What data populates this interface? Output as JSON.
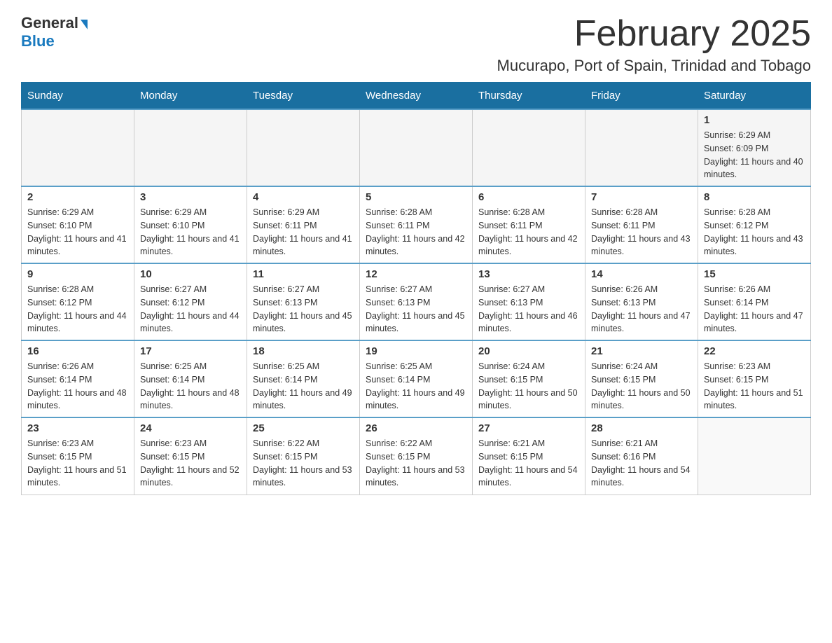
{
  "header": {
    "logo_general": "General",
    "logo_blue": "Blue",
    "month_title": "February 2025",
    "location": "Mucurapo, Port of Spain, Trinidad and Tobago"
  },
  "weekdays": [
    "Sunday",
    "Monday",
    "Tuesday",
    "Wednesday",
    "Thursday",
    "Friday",
    "Saturday"
  ],
  "weeks": [
    {
      "days": [
        {
          "number": "",
          "info": ""
        },
        {
          "number": "",
          "info": ""
        },
        {
          "number": "",
          "info": ""
        },
        {
          "number": "",
          "info": ""
        },
        {
          "number": "",
          "info": ""
        },
        {
          "number": "",
          "info": ""
        },
        {
          "number": "1",
          "info": "Sunrise: 6:29 AM\nSunset: 6:09 PM\nDaylight: 11 hours and 40 minutes."
        }
      ]
    },
    {
      "days": [
        {
          "number": "2",
          "info": "Sunrise: 6:29 AM\nSunset: 6:10 PM\nDaylight: 11 hours and 41 minutes."
        },
        {
          "number": "3",
          "info": "Sunrise: 6:29 AM\nSunset: 6:10 PM\nDaylight: 11 hours and 41 minutes."
        },
        {
          "number": "4",
          "info": "Sunrise: 6:29 AM\nSunset: 6:11 PM\nDaylight: 11 hours and 41 minutes."
        },
        {
          "number": "5",
          "info": "Sunrise: 6:28 AM\nSunset: 6:11 PM\nDaylight: 11 hours and 42 minutes."
        },
        {
          "number": "6",
          "info": "Sunrise: 6:28 AM\nSunset: 6:11 PM\nDaylight: 11 hours and 42 minutes."
        },
        {
          "number": "7",
          "info": "Sunrise: 6:28 AM\nSunset: 6:11 PM\nDaylight: 11 hours and 43 minutes."
        },
        {
          "number": "8",
          "info": "Sunrise: 6:28 AM\nSunset: 6:12 PM\nDaylight: 11 hours and 43 minutes."
        }
      ]
    },
    {
      "days": [
        {
          "number": "9",
          "info": "Sunrise: 6:28 AM\nSunset: 6:12 PM\nDaylight: 11 hours and 44 minutes."
        },
        {
          "number": "10",
          "info": "Sunrise: 6:27 AM\nSunset: 6:12 PM\nDaylight: 11 hours and 44 minutes."
        },
        {
          "number": "11",
          "info": "Sunrise: 6:27 AM\nSunset: 6:13 PM\nDaylight: 11 hours and 45 minutes."
        },
        {
          "number": "12",
          "info": "Sunrise: 6:27 AM\nSunset: 6:13 PM\nDaylight: 11 hours and 45 minutes."
        },
        {
          "number": "13",
          "info": "Sunrise: 6:27 AM\nSunset: 6:13 PM\nDaylight: 11 hours and 46 minutes."
        },
        {
          "number": "14",
          "info": "Sunrise: 6:26 AM\nSunset: 6:13 PM\nDaylight: 11 hours and 47 minutes."
        },
        {
          "number": "15",
          "info": "Sunrise: 6:26 AM\nSunset: 6:14 PM\nDaylight: 11 hours and 47 minutes."
        }
      ]
    },
    {
      "days": [
        {
          "number": "16",
          "info": "Sunrise: 6:26 AM\nSunset: 6:14 PM\nDaylight: 11 hours and 48 minutes."
        },
        {
          "number": "17",
          "info": "Sunrise: 6:25 AM\nSunset: 6:14 PM\nDaylight: 11 hours and 48 minutes."
        },
        {
          "number": "18",
          "info": "Sunrise: 6:25 AM\nSunset: 6:14 PM\nDaylight: 11 hours and 49 minutes."
        },
        {
          "number": "19",
          "info": "Sunrise: 6:25 AM\nSunset: 6:14 PM\nDaylight: 11 hours and 49 minutes."
        },
        {
          "number": "20",
          "info": "Sunrise: 6:24 AM\nSunset: 6:15 PM\nDaylight: 11 hours and 50 minutes."
        },
        {
          "number": "21",
          "info": "Sunrise: 6:24 AM\nSunset: 6:15 PM\nDaylight: 11 hours and 50 minutes."
        },
        {
          "number": "22",
          "info": "Sunrise: 6:23 AM\nSunset: 6:15 PM\nDaylight: 11 hours and 51 minutes."
        }
      ]
    },
    {
      "days": [
        {
          "number": "23",
          "info": "Sunrise: 6:23 AM\nSunset: 6:15 PM\nDaylight: 11 hours and 51 minutes."
        },
        {
          "number": "24",
          "info": "Sunrise: 6:23 AM\nSunset: 6:15 PM\nDaylight: 11 hours and 52 minutes."
        },
        {
          "number": "25",
          "info": "Sunrise: 6:22 AM\nSunset: 6:15 PM\nDaylight: 11 hours and 53 minutes."
        },
        {
          "number": "26",
          "info": "Sunrise: 6:22 AM\nSunset: 6:15 PM\nDaylight: 11 hours and 53 minutes."
        },
        {
          "number": "27",
          "info": "Sunrise: 6:21 AM\nSunset: 6:15 PM\nDaylight: 11 hours and 54 minutes."
        },
        {
          "number": "28",
          "info": "Sunrise: 6:21 AM\nSunset: 6:16 PM\nDaylight: 11 hours and 54 minutes."
        },
        {
          "number": "",
          "info": ""
        }
      ]
    }
  ]
}
